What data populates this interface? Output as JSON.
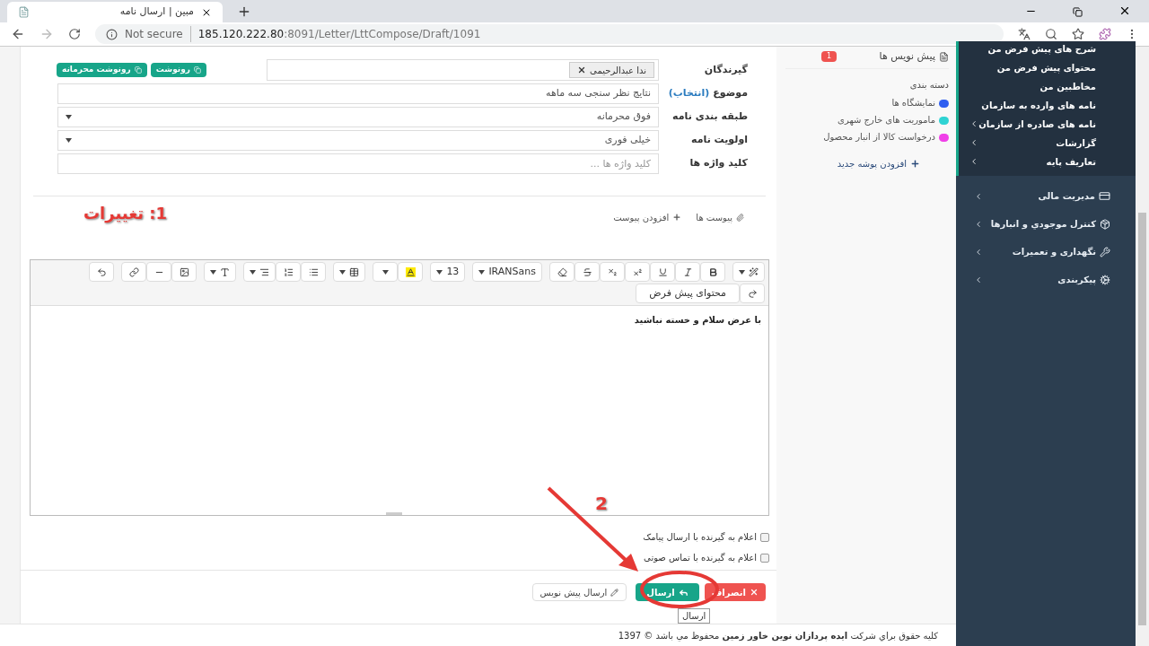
{
  "browser": {
    "tab_title": "مبین | ارسال نامه",
    "security": "Not secure",
    "host": "185.120.222.80",
    "path": ":8091/Letter/LttCompose/Draft/1091"
  },
  "form": {
    "recipients_label": "گیرندگان",
    "recipients": [
      {
        "name": "ندا عبدالرحیمی"
      }
    ],
    "copy_buttons": [
      "رونوشت",
      "رونوشت محرمانه"
    ],
    "subject_label": "موضوع",
    "subject_link": "(انتخاب)",
    "subject_value": "نتایج نظر سنجی سه ماهه",
    "classification_label": "طبقه بندی نامه",
    "classification_value": "فوق محرمانه",
    "priority_label": "اولویت نامه",
    "priority_value": "خیلی فوری",
    "keywords_label": "کلید واژه ها",
    "keywords_placeholder": "کلید واژه ها ..."
  },
  "attachments": {
    "label": "پیوست ها",
    "add": "افزودن پیوست"
  },
  "editor": {
    "font_size": "13",
    "font_name": "IRANSans",
    "default_content": "محتوای پیش فرض",
    "body": "با عرض سلام و خسته نباشید"
  },
  "notify_options": [
    {
      "label": "اعلام به گیرنده با ارسال پیامک",
      "checked": false
    },
    {
      "label": "اعلام به گیرنده با تماس صوتی",
      "checked": false
    }
  ],
  "actions": {
    "cancel": "انصراف",
    "send": "ارسال",
    "draft": "ارسال پیش نویس",
    "tooltip": "ارسال"
  },
  "annotations": {
    "step1": "1: تغییرات",
    "step2": "2"
  },
  "footer": "کلیه حقوق براي شرکت **ایده پردازان نوین خاور زمین** محفوظ مي باشد © 1397",
  "folders": {
    "drafts_label": "پیش نویس ها",
    "drafts_count": "1",
    "categories_title": "دسته بندی",
    "categories": [
      {
        "label": "نمایشگاه ها",
        "color": "#2f5ff0"
      },
      {
        "label": "ماموریت های خارج شهری",
        "color": "#2fd3d3"
      },
      {
        "label": "درخواست کالا از انبار محصول",
        "color": "#f040e8"
      }
    ],
    "add_folder": "افزودن پوشه جدید"
  },
  "sidebar": {
    "submenu": [
      {
        "label": "شرح های پیش فرض من",
        "has_children": false
      },
      {
        "label": "محتوای پیش فرض من",
        "has_children": false
      },
      {
        "label": "مخاطبین من",
        "has_children": false
      },
      {
        "label": "نامه های وارده به سازمان",
        "has_children": false
      },
      {
        "label": "نامه های صادره از سازمان",
        "has_children": true
      },
      {
        "label": "گزارشات",
        "has_children": true
      },
      {
        "label": "تعاریف پایه",
        "has_children": true
      }
    ],
    "items": [
      {
        "label": "مدیریت مالی",
        "kind": "finance"
      },
      {
        "label": "کنترل موجودي و انبارها",
        "kind": "inventory"
      },
      {
        "label": "نگهداری و تعمیرات",
        "kind": "maintenance"
      },
      {
        "label": "پیکربندی",
        "kind": "settings"
      }
    ]
  }
}
